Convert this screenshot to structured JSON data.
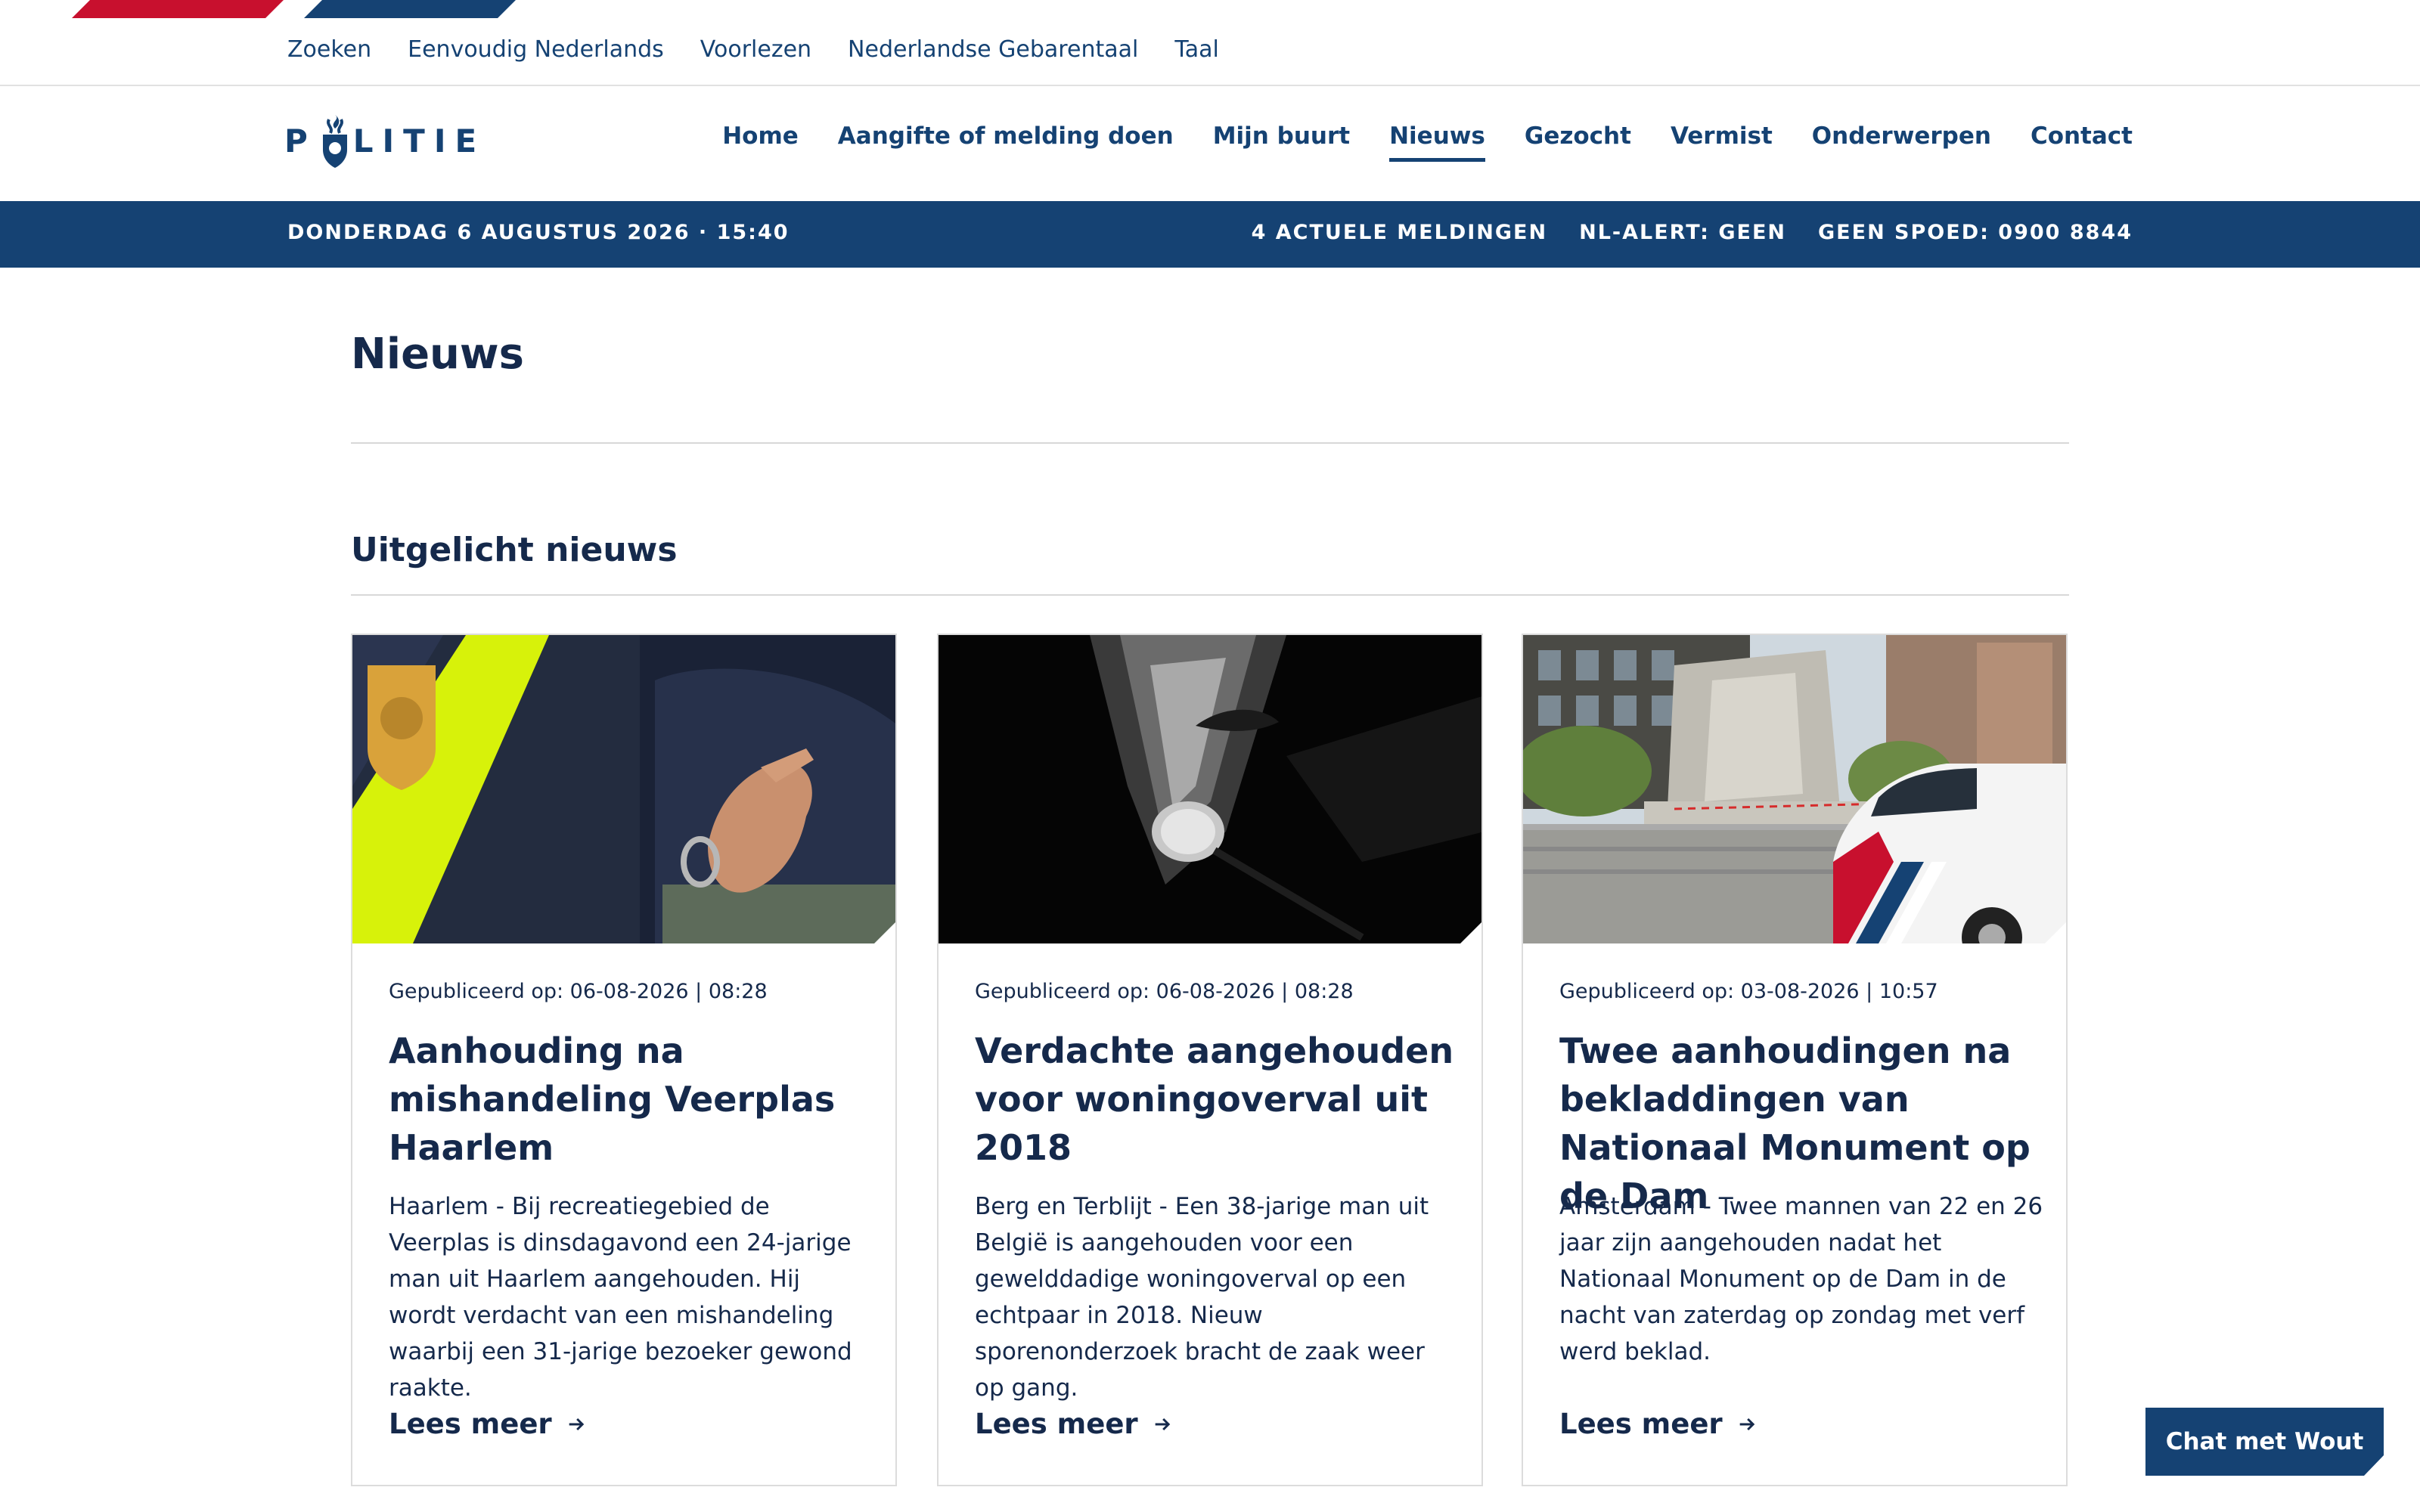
{
  "colors": {
    "brand_blue": "#154273",
    "brand_red": "#c8102e",
    "text_dark": "#15294b"
  },
  "utility_nav": [
    "Zoeken",
    "Eenvoudig Nederlands",
    "Voorlezen",
    "Nederlandse Gebarentaal",
    "Taal"
  ],
  "logo": {
    "text_left": "P",
    "text_right": "LITIE",
    "icon": "police-badge-icon"
  },
  "main_nav": {
    "items": [
      "Home",
      "Aangifte of melding doen",
      "Mijn buurt",
      "Nieuws",
      "Gezocht",
      "Vermist",
      "Onderwerpen",
      "Contact"
    ],
    "active": "Nieuws"
  },
  "status_bar": {
    "date": "DONDERDAG 6 AUGUSTUS 2026 · 15:40",
    "reports": "4 ACTUELE MELDINGEN",
    "nl_alert": "NL-ALERT: GEEN",
    "non_emergency": "GEEN SPOED: 0900 8844"
  },
  "page_title": "Nieuws",
  "section_title": "Uitgelicht nieuws",
  "cards": [
    {
      "image": "arrest-handcuffs-image",
      "meta": "Gepubliceerd op: 06-08-2026 | 08:28",
      "title": "Aanhouding na mishandeling Veerplas Haarlem",
      "description": "Haarlem - Bij recreatiegebied de Veerplas is dinsdagavond een 24-jarige man uit Haarlem aangehouden. Hij wordt verdacht van een mishandeling waarbij een 31-jarige bezoeker gewond raakte.",
      "link": "Lees meer"
    },
    {
      "image": "magnifying-glass-investigation-image",
      "meta": "Gepubliceerd op: 06-08-2026 | 08:28",
      "title": "Verdachte aangehouden voor woningoverval uit 2018",
      "description": "Berg en Terblijt - Een 38-jarige man uit België is aangehouden voor een gewelddadige woningoverval op een echtpaar in 2018. Nieuw sporenonderzoek bracht de zaak weer op gang.",
      "link": "Lees meer"
    },
    {
      "image": "national-monument-dam-police-car-image",
      "meta": "Gepubliceerd op: 03-08-2026 | 10:57",
      "title": "Twee aanhoudingen na bekladdingen van Nationaal Monument op de Dam",
      "description": "Amsterdam - Twee mannen van 22 en 26 jaar zijn aangehouden nadat het Nationaal Monument op de Dam in de nacht van zaterdag op zondag met verf werd beklad.",
      "link": "Lees meer"
    }
  ],
  "chat_button": "Chat met Wout"
}
